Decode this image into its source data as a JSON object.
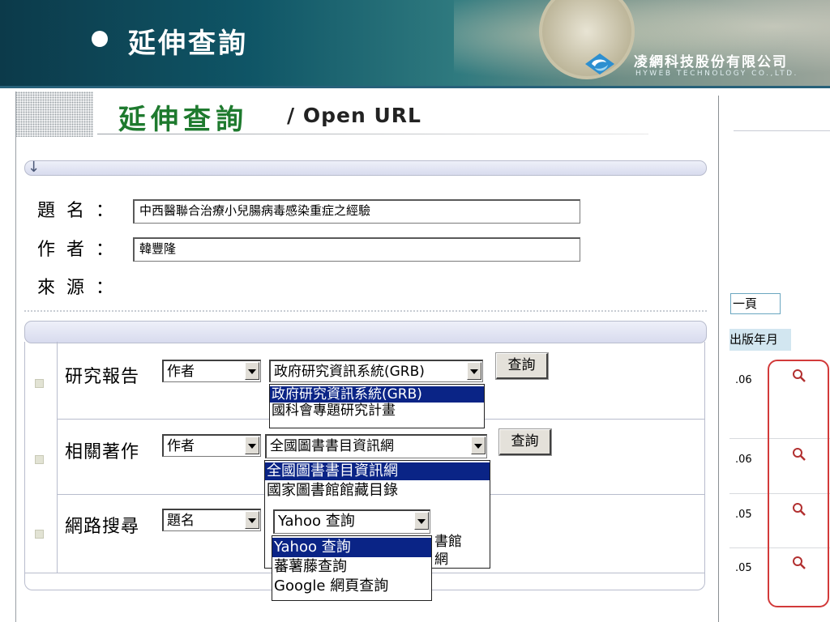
{
  "banner": {
    "title": "延伸查詢",
    "company_zh": "凌網科技股份有限公司",
    "company_en": "HYWEB TECHNOLOGY CO.,LTD."
  },
  "page": {
    "title_zh": "延伸查詢",
    "title_sep_en": "/ Open URL"
  },
  "fields": [
    {
      "label": "題名",
      "colon": "：",
      "value": "中西醫聯合治療小兒腸病毒感染重症之經驗"
    },
    {
      "label": "作者",
      "colon": "：",
      "value": "韓豐隆"
    },
    {
      "label": "來源",
      "colon": "：",
      "value": ""
    }
  ],
  "rows": [
    {
      "label": "研究報告",
      "field_select": "作者",
      "source_select": "政府研究資訊系統(GRB)",
      "button": "查詢",
      "dropdown_options": [
        "政府研究資訊系統(GRB)",
        "國科會專題研究計畫"
      ]
    },
    {
      "label": "相關著作",
      "field_select": "作者",
      "source_select": "全國圖書書目資訊網",
      "button": "查詢",
      "dropdown_options": [
        "全國圖書書目資訊網",
        "國家圖書館館藏目錄"
      ],
      "hidden_partial": [
        "書館",
        "網"
      ]
    },
    {
      "label": "網路搜尋",
      "field_select": "題名",
      "source_select": "Yahoo 查詢",
      "dropdown_options": [
        "Yahoo 查詢",
        "蕃薯藤查詢",
        "Google 網頁查詢"
      ]
    }
  ],
  "right_panel": {
    "page_button": "一頁",
    "column_header": "出版年月",
    "rows": [
      ".06",
      ".06",
      ".05",
      ".05"
    ]
  },
  "colors": {
    "banner": "#0f5566",
    "title_green": "#1e7a2e",
    "selected_option": "#0a2486",
    "highlight_frame": "#d23a3a"
  },
  "icons": [
    "arrow-down-icon",
    "square-bullet-icon",
    "magnifier-icon",
    "company-logo-icon",
    "compass-icon"
  ]
}
